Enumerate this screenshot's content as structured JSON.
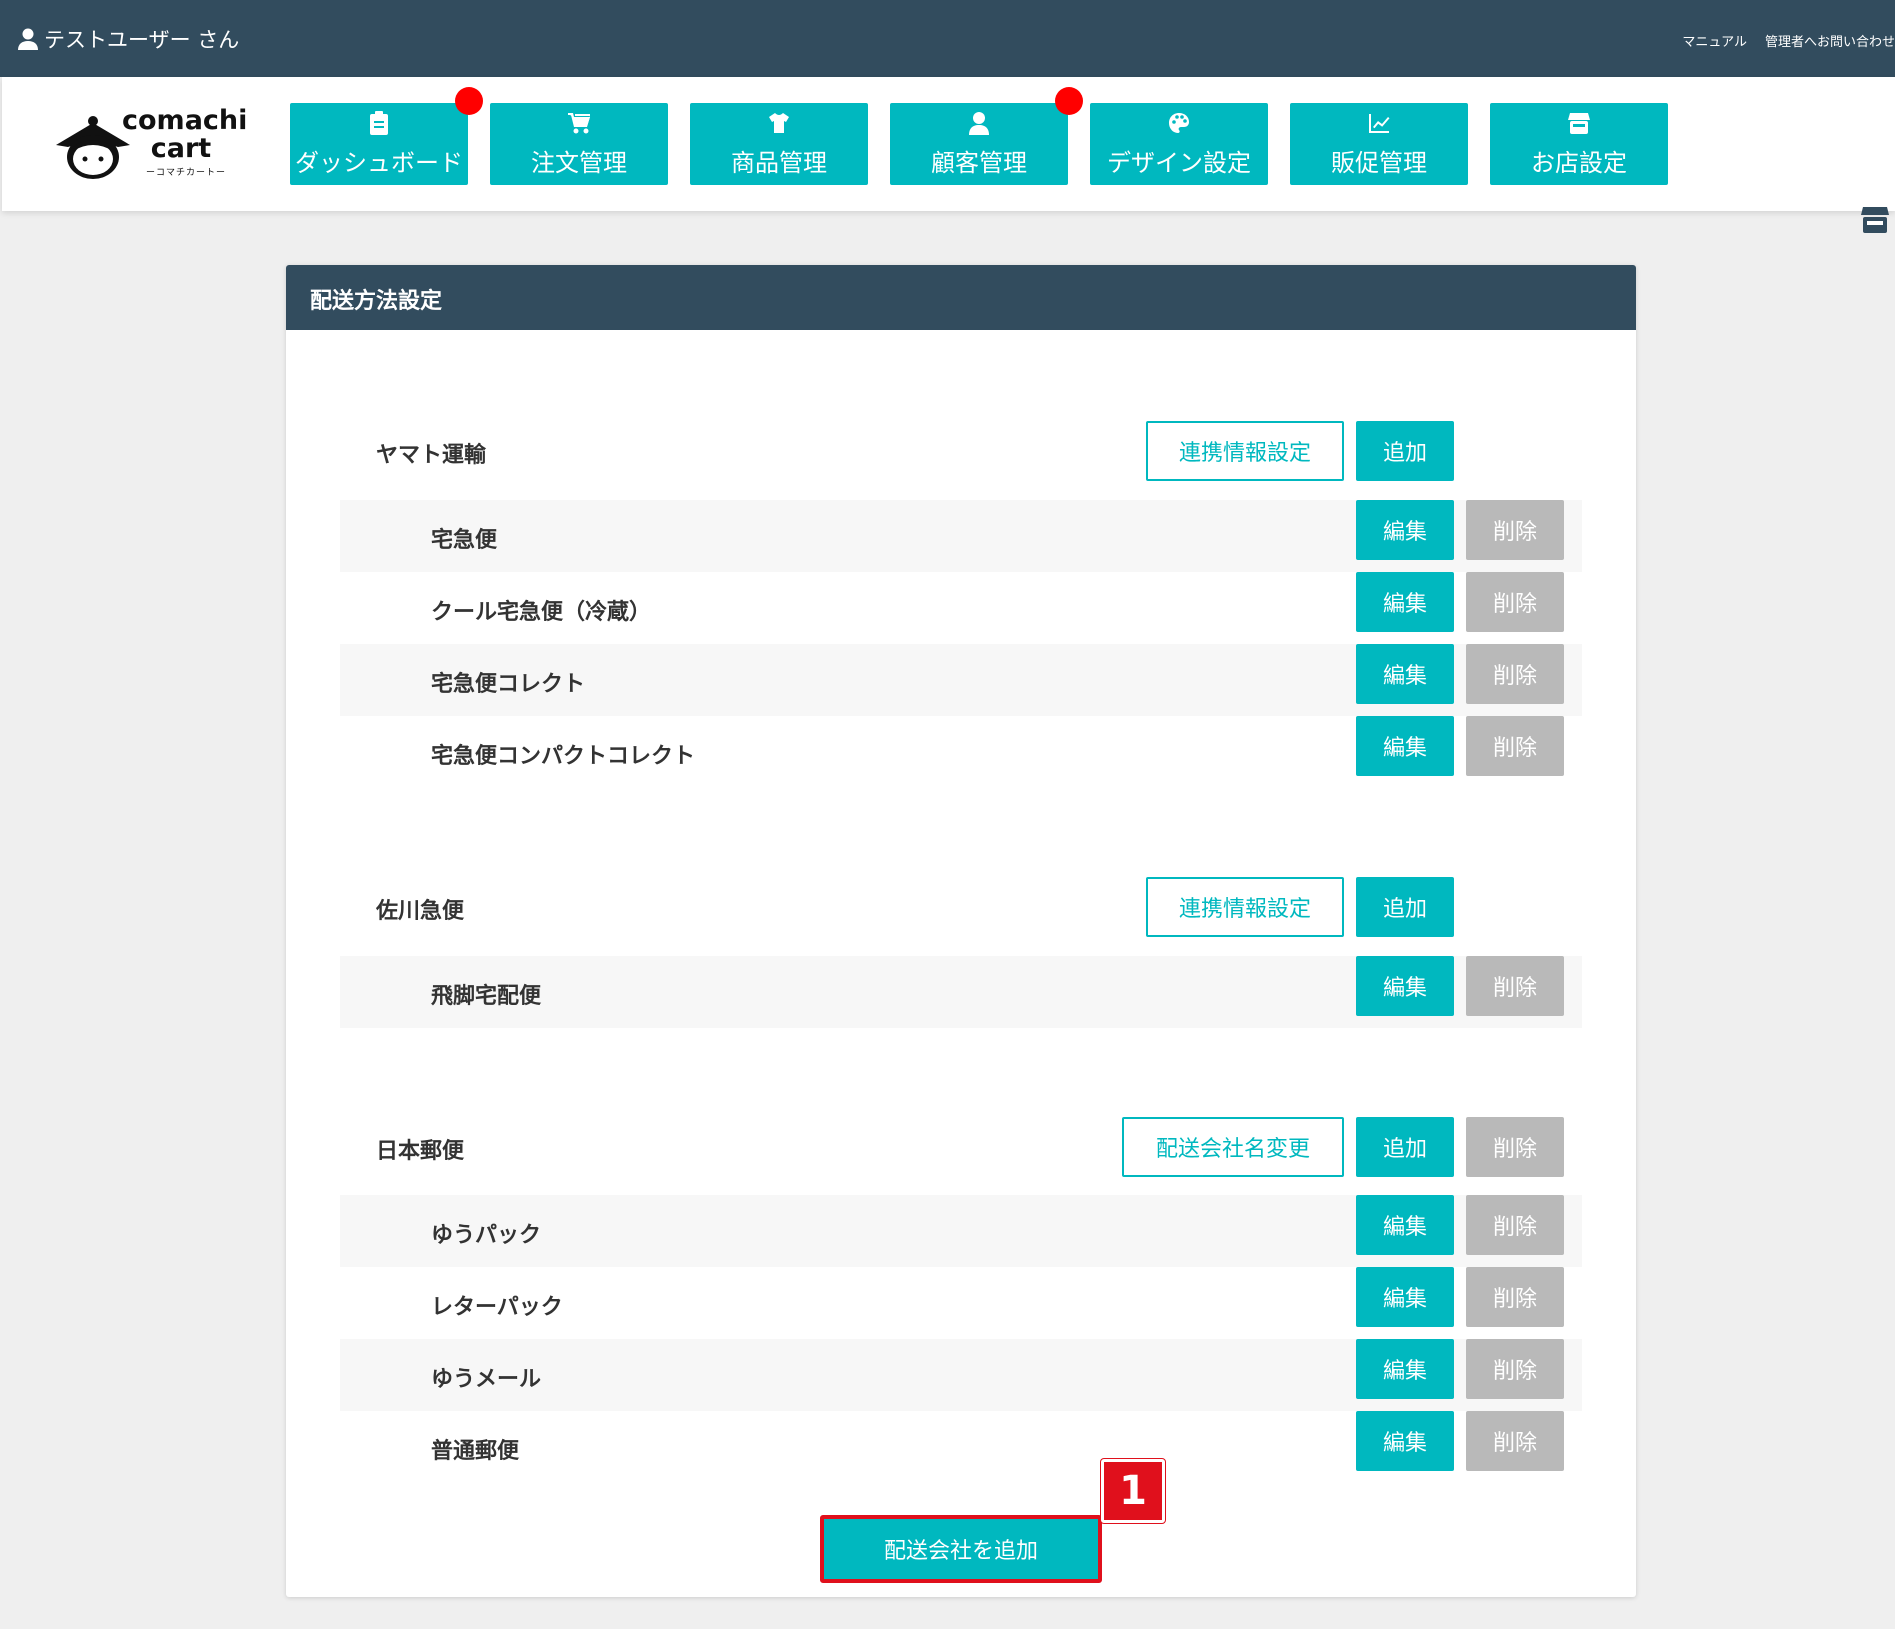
{
  "topbar": {
    "user_label": "テストユーザー さん",
    "links": [
      "マニュアル",
      "管理者へお問い合わせ"
    ]
  },
  "logo": {
    "word1": "comachi",
    "word2": "cart",
    "sub": "ーコマチカートー"
  },
  "nav": {
    "items": [
      {
        "label": "ダッシュボード",
        "icon": "clipboard-icon",
        "notify": true
      },
      {
        "label": "注文管理",
        "icon": "cart-icon",
        "notify": false
      },
      {
        "label": "商品管理",
        "icon": "tshirt-icon",
        "notify": false
      },
      {
        "label": "顧客管理",
        "icon": "user-icon",
        "notify": true
      },
      {
        "label": "デザイン設定",
        "icon": "palette-icon",
        "notify": false
      },
      {
        "label": "販促管理",
        "icon": "chart-icon",
        "notify": false
      },
      {
        "label": "お店設定",
        "icon": "store-icon",
        "notify": false
      }
    ]
  },
  "panel": {
    "title": "配送方法設定",
    "companies": [
      {
        "name": "ヤマト運輸",
        "settings_label": "連携情報設定",
        "add_label": "追加",
        "services": [
          "宅急便",
          "クール宅急便（冷蔵）",
          "宅急便コレクト",
          "宅急便コンパクトコレクト"
        ]
      },
      {
        "name": "佐川急便",
        "settings_label": "連携情報設定",
        "add_label": "追加",
        "services": [
          "飛脚宅配便"
        ]
      },
      {
        "name": "日本郵便",
        "settings_label": "配送会社名変更",
        "add_label": "追加",
        "delete_label": "削除",
        "services": [
          "ゆうパック",
          "レターパック",
          "ゆうメール",
          "普通郵便"
        ]
      }
    ],
    "edit_label": "編集",
    "delete_label": "削除",
    "add_company_label": "配送会社を追加",
    "step_badge": "1"
  },
  "colors": {
    "header": "#324c5e",
    "accent": "#00b8bf",
    "gray_button": "#b9b9b9",
    "highlight": "#e0101c"
  }
}
